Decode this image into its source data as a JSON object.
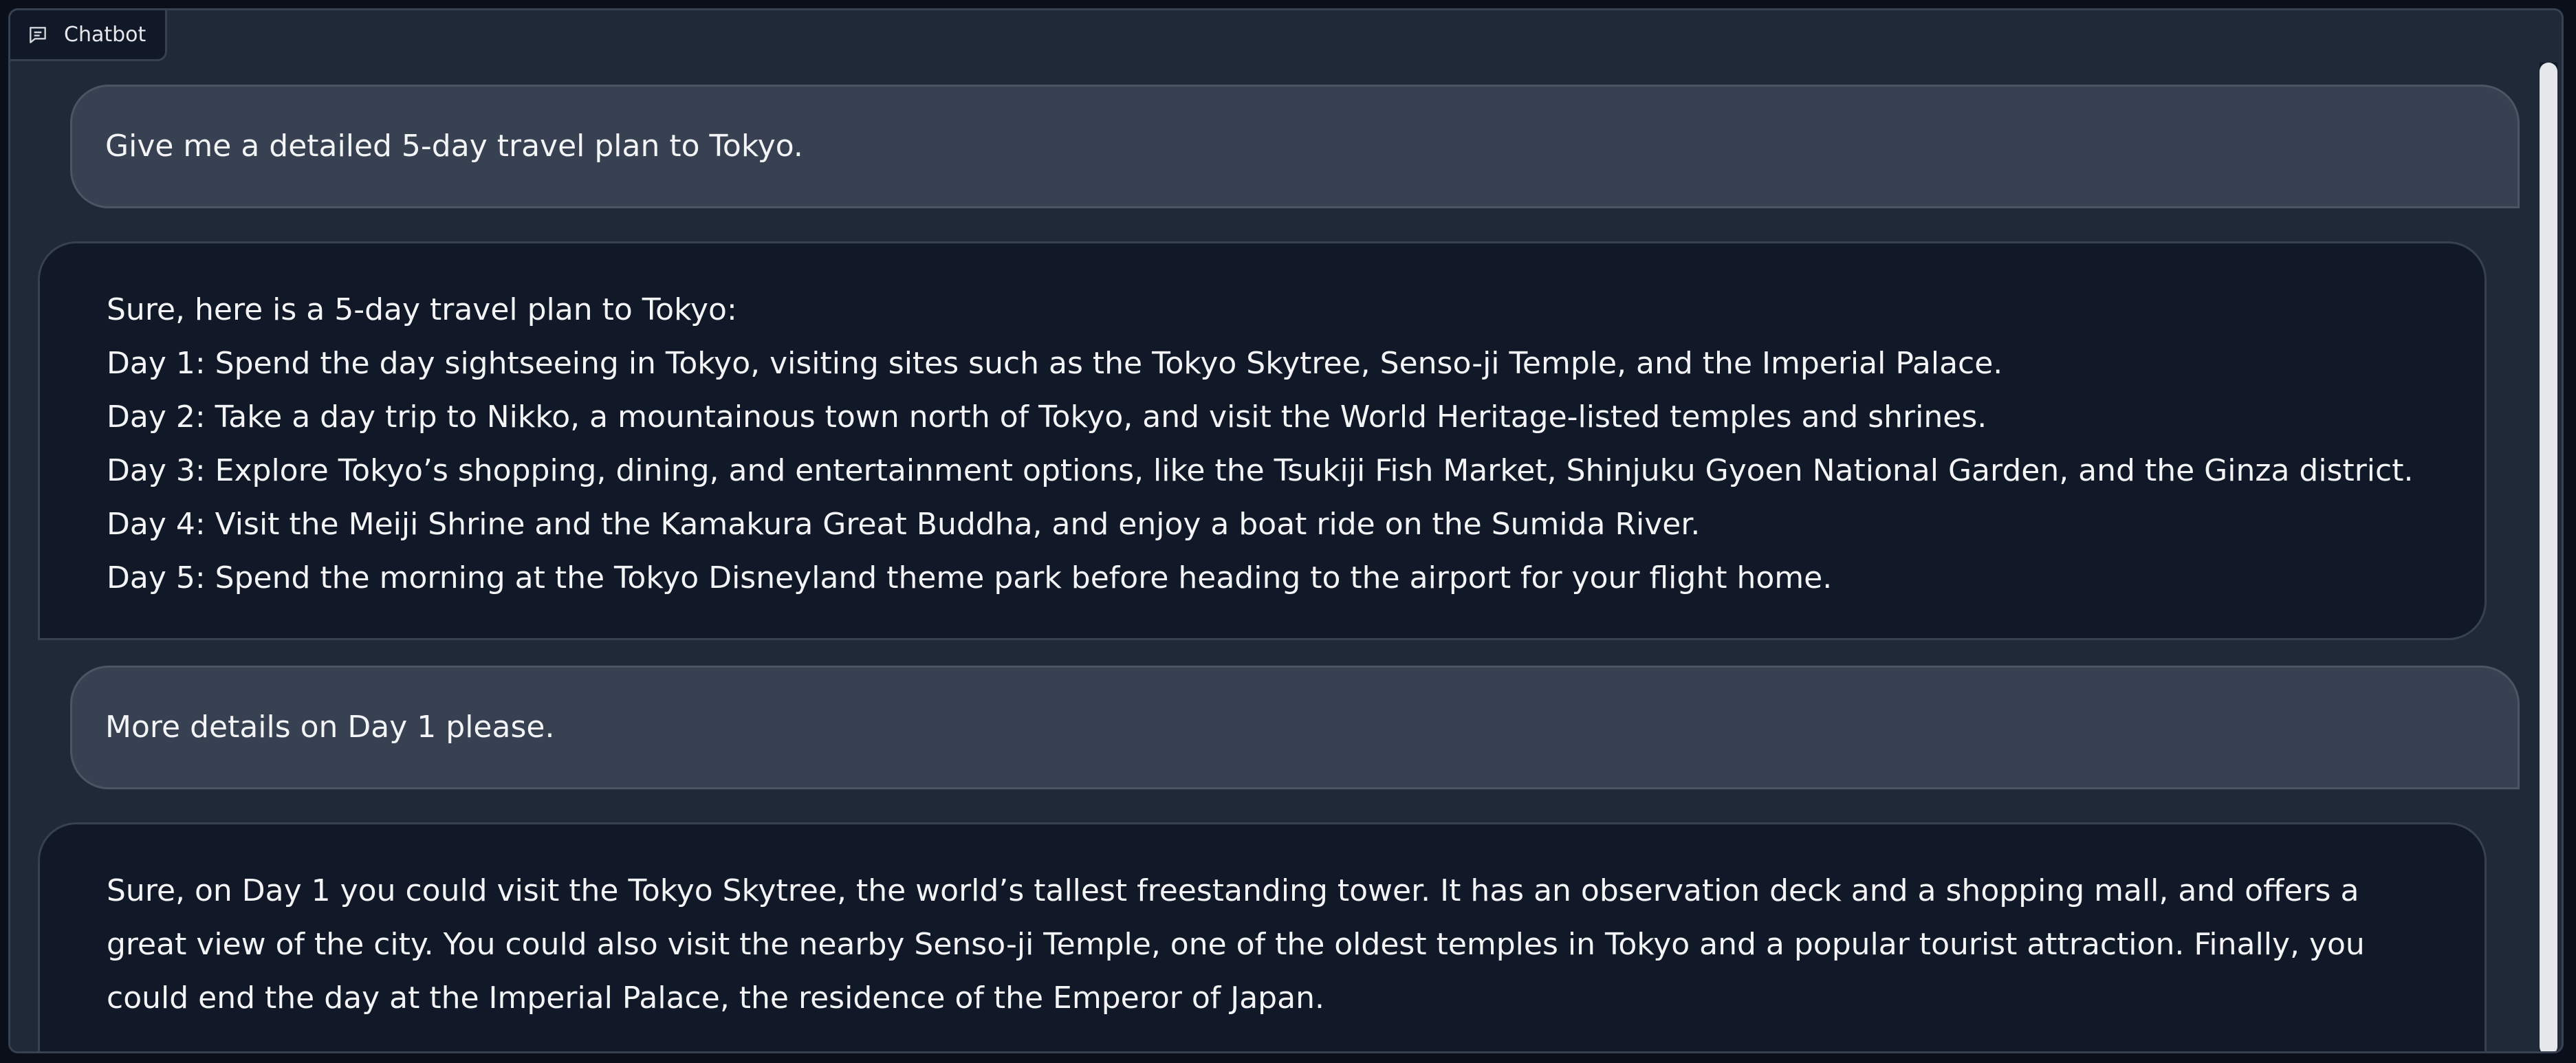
{
  "chatbot": {
    "label": "Chatbot",
    "label_icon": "chat-bubble-icon",
    "messages": [
      {
        "role": "user",
        "text": "Give me a detailed 5-day travel plan to Tokyo."
      },
      {
        "role": "bot",
        "lines": [
          "Sure, here is a 5-day travel plan to Tokyo:",
          "Day 1: Spend the day sightseeing in Tokyo, visiting sites such as the Tokyo Skytree, Senso-ji Temple, and the Imperial Palace.",
          "Day 2: Take a day trip to Nikko, a mountainous town north of Tokyo, and visit the World Heritage-listed temples and shrines.",
          "Day 3: Explore Tokyo’s shopping, dining, and entertainment options, like the Tsukiji Fish Market, Shinjuku Gyoen National Garden, and the Ginza district.",
          "Day 4: Visit the Meiji Shrine and the Kamakura Great Buddha, and enjoy a boat ride on the Sumida River.",
          "Day 5: Spend the morning at the Tokyo Disneyland theme park before heading to the airport for your flight home."
        ]
      },
      {
        "role": "user",
        "text": "More details on Day 1 please."
      },
      {
        "role": "bot",
        "lines": [
          "Sure, on Day 1 you could visit the Tokyo Skytree, the world’s tallest freestanding tower. It has an observation deck and a shopping mall, and offers a great view of the city. You could also visit the nearby Senso-ji Temple, one of the oldest temples in Tokyo and a popular tourist attraction. Finally, you could end the day at the Imperial Palace, the residence of the Emperor of Japan."
        ]
      }
    ]
  },
  "colors": {
    "page_bg": "#0b0f19",
    "panel_bg": "#1f2937",
    "user_bubble": "#374151",
    "bot_bubble": "#111827",
    "text": "#f3f4f6"
  }
}
